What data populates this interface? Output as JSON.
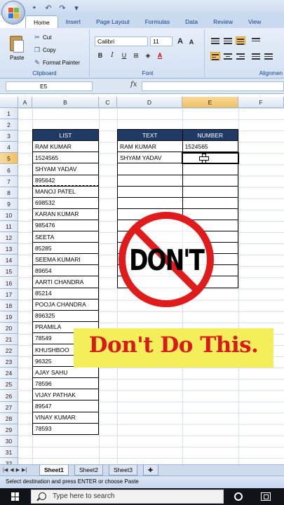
{
  "qat": {
    "icons": [
      "save-icon",
      "undo-icon",
      "redo-icon",
      "dropdown-icon"
    ]
  },
  "tabs": [
    "Home",
    "Insert",
    "Page Layout",
    "Formulas",
    "Data",
    "Review",
    "View"
  ],
  "ribbon": {
    "paste_label": "Paste",
    "cut_label": "Cut",
    "copy_label": "Copy",
    "format_painter_label": "Format Painter",
    "clipboard_group": "Clipboard",
    "font_name": "Calibri",
    "font_size": "11",
    "grow_label": "A",
    "shrink_label": "A",
    "bold": "B",
    "italic": "I",
    "underline": "U",
    "font_color_label": "A",
    "font_group": "Font",
    "alignment_group": "Alignmen"
  },
  "formula_bar": {
    "name_box": "E5",
    "fx": "fx",
    "formula": ""
  },
  "columns": [
    "A",
    "B",
    "C",
    "D",
    "E",
    "F"
  ],
  "rows": [
    "1",
    "2",
    "3",
    "4",
    "5",
    "6",
    "7",
    "8",
    "9",
    "10",
    "11",
    "12",
    "13",
    "14",
    "15",
    "16",
    "17",
    "18",
    "19",
    "20",
    "21",
    "22",
    "23",
    "24",
    "25",
    "26",
    "27",
    "28",
    "29",
    "30",
    "31",
    "32"
  ],
  "list_table": {
    "header": "LIST",
    "values": [
      "RAM KUMAR",
      "1524565",
      "SHYAM YADAV",
      "895642",
      "MANOJ PATEL",
      "698532",
      "KARAN KUMAR",
      "985476",
      "SEETA",
      "85285",
      "SEEMA KUMARI",
      "89654",
      "AARTI CHANDRA",
      "85214",
      "POOJA CHANDRA",
      "896325",
      "PRAMILA",
      "78549",
      "KHUSHBOO",
      "96325",
      "AJAY SAHU",
      "78596",
      "VIJAY PATHAK",
      "89547",
      "VINAY KUMAR",
      "78593"
    ]
  },
  "split_table": {
    "header_text": "TEXT",
    "header_number": "NUMBER",
    "rows": [
      {
        "text": "RAM KUMAR",
        "number": "1524565"
      },
      {
        "text": "SHYAM YADAV",
        "number": ""
      },
      {
        "text": "",
        "number": ""
      },
      {
        "text": "",
        "number": ""
      },
      {
        "text": "",
        "number": ""
      },
      {
        "text": "",
        "number": ""
      },
      {
        "text": "",
        "number": ""
      },
      {
        "text": "",
        "number": ""
      },
      {
        "text": "",
        "number": ""
      },
      {
        "text": "",
        "number": ""
      },
      {
        "text": "",
        "number": ""
      },
      {
        "text": "",
        "number": ""
      },
      {
        "text": "",
        "number": ""
      }
    ]
  },
  "overlay": {
    "sign_text": "DON'T",
    "banner_text": "Don't Do This.",
    "sign_color": "#e01b1b",
    "banner_color": "#f4ee5a"
  },
  "sheets": [
    "Sheet1",
    "Sheet2",
    "Sheet3"
  ],
  "status": "Select destination and press ENTER or choose Paste",
  "taskbar": {
    "search_placeholder": "Type here to search"
  }
}
